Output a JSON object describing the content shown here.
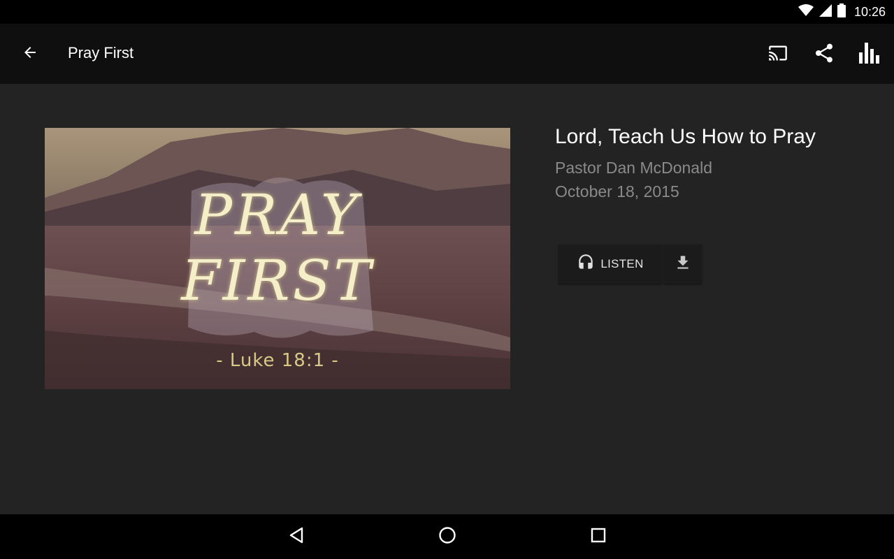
{
  "status_bar": {
    "time": "10:26",
    "icons": [
      "wifi-icon",
      "cell-signal-icon",
      "battery-icon"
    ]
  },
  "app_bar": {
    "title": "Pray First",
    "icons": [
      "back-arrow-icon",
      "cast-icon",
      "share-icon",
      "bar-chart-icon"
    ]
  },
  "sermon": {
    "title": "Lord, Teach Us How to Pray",
    "speaker": "Pastor Dan McDonald",
    "date": "October 18, 2015",
    "artwork": {
      "line1": "PRAY",
      "line2": "FIRST",
      "reference": "- Luke 18:1 -"
    }
  },
  "actions": {
    "listen_label": "LISTEN",
    "listen_icon": "headphones-icon",
    "download_icon": "download-icon"
  },
  "nav_bar": {
    "icons": [
      "back-triangle-icon",
      "home-circle-icon",
      "recents-square-icon"
    ]
  },
  "colors": {
    "background": "#232323",
    "app_bar": "#0f0f0f",
    "secondary_text": "#8a8a8a",
    "button_bg": "#1b1b1b"
  }
}
